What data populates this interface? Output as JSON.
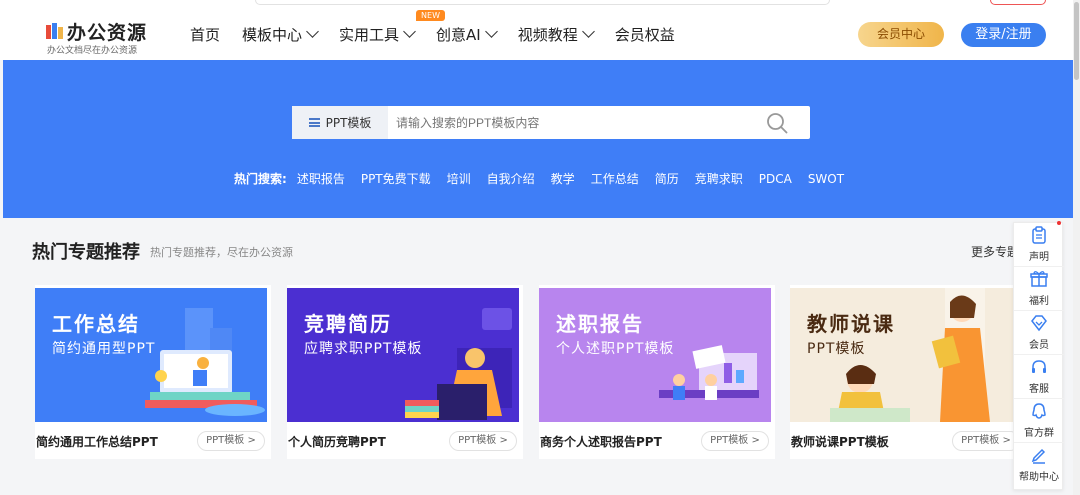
{
  "brand": {
    "name": "办公资源",
    "slogan": "办公文档尽在办公资源"
  },
  "nav": {
    "items": [
      {
        "label": "首页",
        "dropdown": false
      },
      {
        "label": "模板中心",
        "dropdown": true
      },
      {
        "label": "实用工具",
        "dropdown": true
      },
      {
        "label": "创意AI",
        "dropdown": true,
        "badge": "NEW"
      },
      {
        "label": "视频教程",
        "dropdown": true
      },
      {
        "label": "会员权益",
        "dropdown": false
      }
    ],
    "vip_label": "会员中心",
    "login_label": "登录/注册"
  },
  "search": {
    "category": "PPT模板",
    "placeholder": "请输入搜索的PPT模板内容",
    "hot_label": "热门搜索:",
    "hot_keywords": [
      "述职报告",
      "PPT免费下载",
      "培训",
      "自我介绍",
      "教学",
      "工作总结",
      "简历",
      "竞聘求职",
      "PDCA",
      "SWOT"
    ]
  },
  "section": {
    "title": "热门专题推荐",
    "subtitle": "热门专题推荐，尽在办公资源",
    "more_label": "更多专题"
  },
  "cards": [
    {
      "title": "工作总结",
      "subtitle": "简约通用型PPT",
      "caption": "简约通用工作总结PPT",
      "tag": "PPT模板 >",
      "color": "#3f7ef7"
    },
    {
      "title": "竞聘简历",
      "subtitle": "应聘求职PPT模板",
      "caption": "个人简历竞聘PPT",
      "tag": "PPT模板 >",
      "color": "#4b2fd1"
    },
    {
      "title": "述职报告",
      "subtitle": "个人述职PPT模板",
      "caption": "商务个人述职报告PPT",
      "tag": "PPT模板 >",
      "color": "#b885ee"
    },
    {
      "title": "教师说课",
      "subtitle": "PPT模板",
      "caption": "教师说课PPT模板",
      "tag": "PPT模板 >",
      "color": "#f5ecdd"
    }
  ],
  "float_bar": {
    "items": [
      {
        "label": "声明",
        "icon": "clipboard-icon"
      },
      {
        "label": "福利",
        "icon": "gift-icon"
      },
      {
        "label": "会员",
        "icon": "diamond-icon"
      },
      {
        "label": "客服",
        "icon": "headset-icon"
      },
      {
        "label": "官方群",
        "icon": "qq-icon"
      },
      {
        "label": "帮助中心",
        "icon": "edit-icon"
      }
    ]
  },
  "colors": {
    "hero": "#3f7ef7",
    "accent": "#3a7ff0",
    "vip_gold": "#f0b54a"
  }
}
